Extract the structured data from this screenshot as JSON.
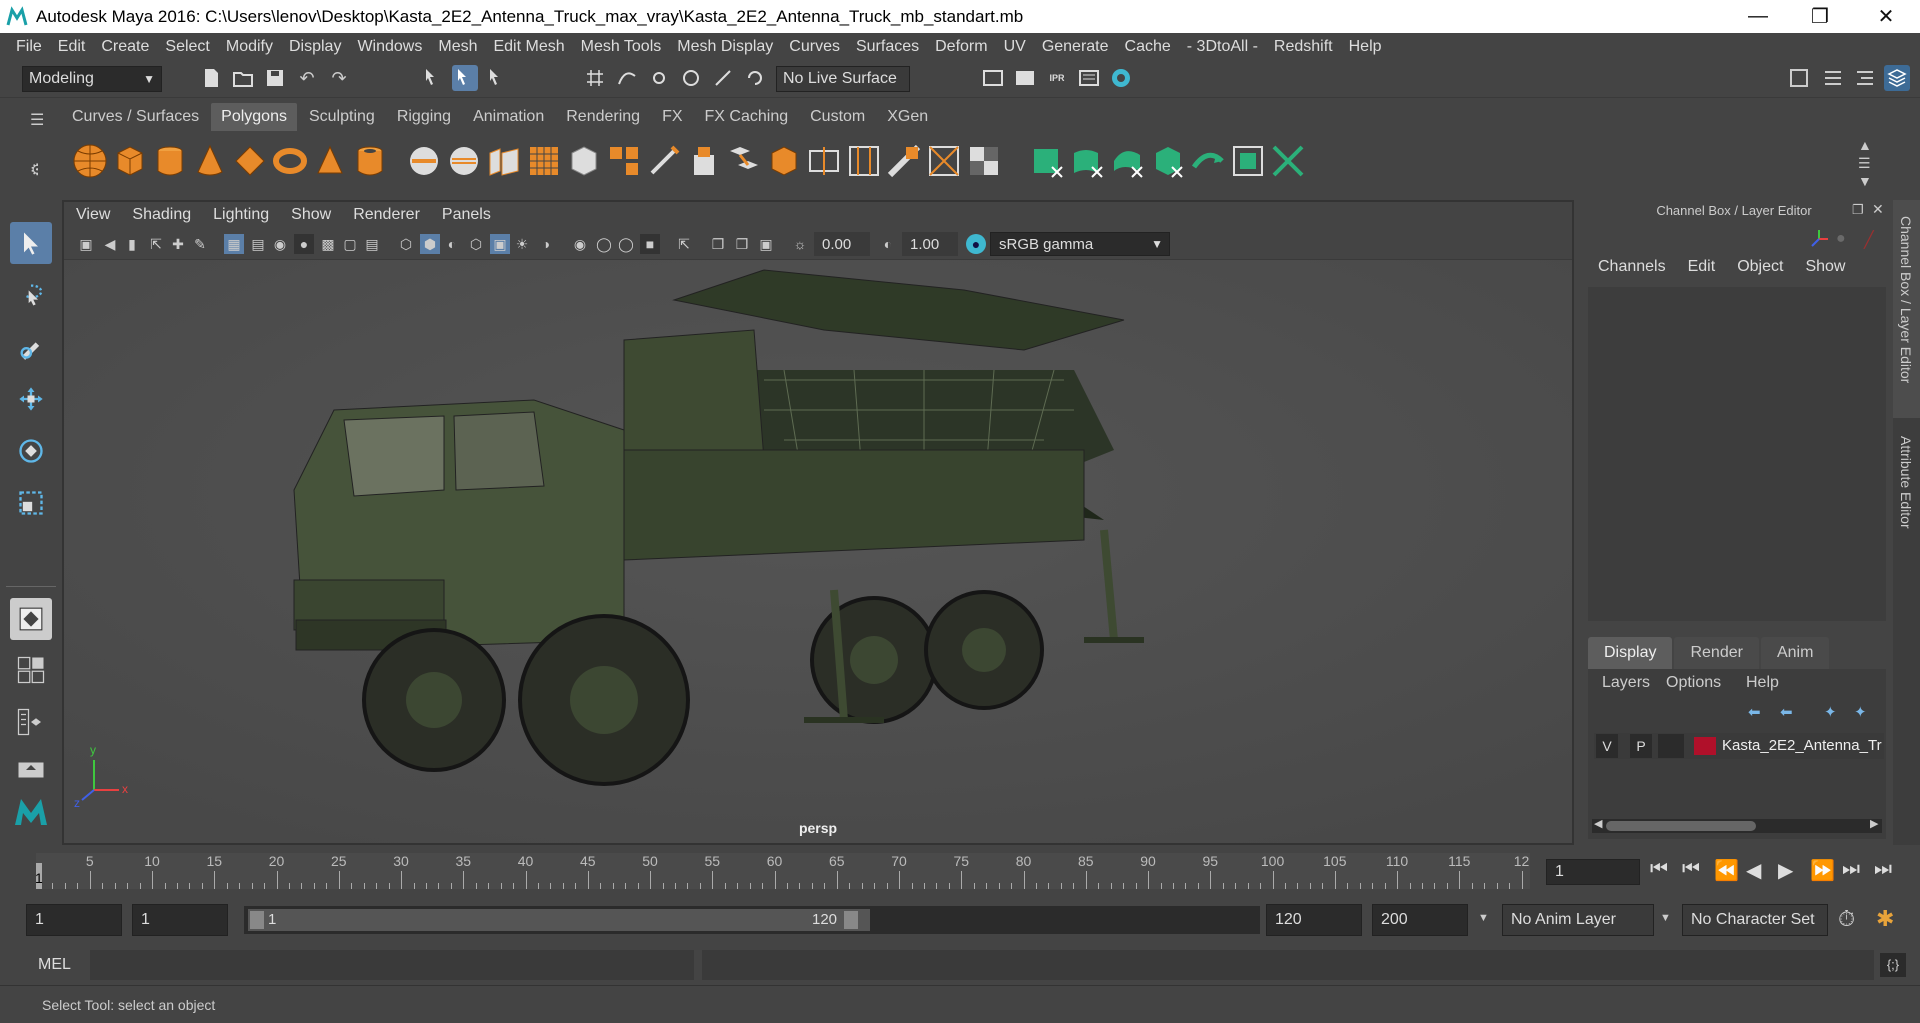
{
  "window": {
    "title": "Autodesk Maya 2016: C:\\Users\\lenov\\Desktop\\Kasta_2E2_Antenna_Truck_max_vray\\Kasta_2E2_Antenna_Truck_mb_standart.mb",
    "minimize_icon": "minimize-icon",
    "maximize_icon": "restore-icon",
    "close_icon": "close-icon"
  },
  "menubar": [
    "File",
    "Edit",
    "Create",
    "Select",
    "Modify",
    "Display",
    "Windows",
    "Mesh",
    "Edit Mesh",
    "Mesh Tools",
    "Mesh Display",
    "Curves",
    "Surfaces",
    "Deform",
    "UV",
    "Generate",
    "Cache",
    "- 3DtoAll -",
    "Redshift",
    "Help"
  ],
  "statusline": {
    "mode": "Modeling",
    "live_surface": "No Live Surface"
  },
  "shelf": {
    "tabs": [
      "Curves / Surfaces",
      "Polygons",
      "Sculpting",
      "Rigging",
      "Animation",
      "Rendering",
      "FX",
      "FX Caching",
      "Custom",
      "XGen"
    ],
    "active_tab": "Polygons"
  },
  "viewport": {
    "menu": [
      "View",
      "Shading",
      "Lighting",
      "Show",
      "Renderer",
      "Panels"
    ],
    "exposure": "0.00",
    "gamma": "1.00",
    "color_space": "sRGB gamma",
    "camera_label": "persp",
    "axis_labels": {
      "x": "x",
      "y": "y",
      "z": "z"
    }
  },
  "channel_box": {
    "title": "Channel Box / Layer Editor",
    "menu": [
      "Channels",
      "Edit",
      "Object",
      "Show"
    ],
    "side_tabs": [
      "Channel Box / Layer Editor",
      "Attribute Editor"
    ]
  },
  "layer_editor": {
    "tabs": [
      "Display",
      "Render",
      "Anim"
    ],
    "active_tab": "Display",
    "menu": [
      "Layers",
      "Options",
      "Help"
    ],
    "layers": [
      {
        "v": "V",
        "p": "P",
        "color": "#b0102a",
        "name": "Kasta_2E2_Antenna_Tr"
      }
    ]
  },
  "timeline": {
    "labels": [
      "5",
      "10",
      "15",
      "20",
      "25",
      "30",
      "35",
      "40",
      "45",
      "50",
      "55",
      "60",
      "65",
      "70",
      "75",
      "80",
      "85",
      "90",
      "95",
      "100",
      "105",
      "110",
      "115",
      "12"
    ],
    "current_frame_marker": "1",
    "current_frame_field": "1"
  },
  "range": {
    "start": "1",
    "playback_start": "1",
    "slider_start": "1",
    "slider_end": "120",
    "playback_end": "120",
    "end": "200",
    "anim_layer": "No Anim Layer",
    "character_set": "No Character Set"
  },
  "command": {
    "language": "MEL",
    "input": ""
  },
  "help_line": "Select Tool: select an object"
}
